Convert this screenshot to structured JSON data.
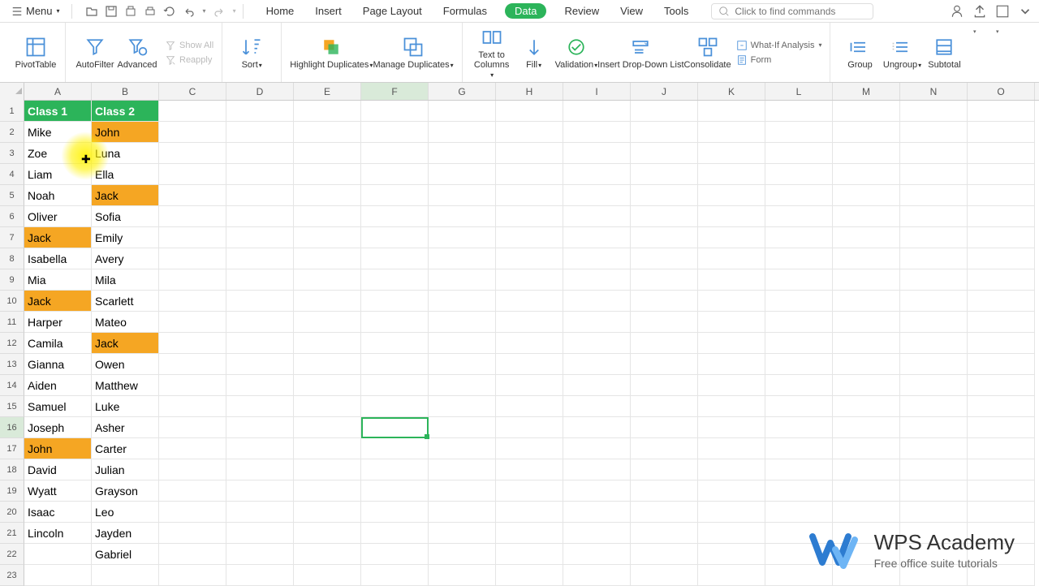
{
  "menu": {
    "label": "Menu"
  },
  "tabs": [
    "Home",
    "Insert",
    "Page Layout",
    "Formulas",
    "Data",
    "Review",
    "View",
    "Tools"
  ],
  "activeTab": "Data",
  "search": {
    "placeholder": "Click to find commands"
  },
  "ribbon": {
    "pivotTable": "PivotTable",
    "autoFilter": "AutoFilter",
    "advanced": "Advanced",
    "showAll": "Show All",
    "reapply": "Reapply",
    "sort": "Sort",
    "highlightDuplicates": "Highlight Duplicates",
    "manageDuplicates": "Manage Duplicates",
    "textToColumns": "Text to\nColumns",
    "fill": "Fill",
    "validation": "Validation",
    "insertDropDown": "Insert Drop-Down List",
    "consolidate": "Consolidate",
    "whatIf": "What-If Analysis",
    "form": "Form",
    "group": "Group",
    "ungroup": "Ungroup",
    "subtotal": "Subtotal"
  },
  "columns": [
    "A",
    "B",
    "C",
    "D",
    "E",
    "F",
    "G",
    "H",
    "I",
    "J",
    "K",
    "L",
    "M",
    "N",
    "O"
  ],
  "selectedColumn": "F",
  "selectedRow": 16,
  "selectedCell": "F16",
  "headers": {
    "A": "Class 1",
    "B": "Class 2"
  },
  "gridData": {
    "A": [
      "Mike",
      "Zoe",
      "Liam",
      "Noah",
      "Oliver",
      "Jack",
      "Isabella",
      "Mia",
      "Jack",
      "Harper",
      "Camila",
      "Gianna",
      "Aiden",
      "Samuel",
      "Joseph",
      "John",
      "David",
      "Wyatt",
      "Isaac",
      "Lincoln",
      ""
    ],
    "B": [
      "John",
      "Luna",
      "Ella",
      "Jack",
      "Sofia",
      "Emily",
      "Avery",
      "Mila",
      "Scarlett",
      "Mateo",
      "Jack",
      "Owen",
      "Matthew",
      "Luke",
      "Asher",
      "Carter",
      "Julian",
      "Grayson",
      "Leo",
      "Jayden",
      "Gabriel"
    ]
  },
  "highlightedOrange": [
    "A7",
    "A10",
    "A17",
    "B2",
    "B5",
    "B12"
  ],
  "cursorHighlight": {
    "row": 3,
    "col": "A"
  },
  "watermark": {
    "title": "WPS Academy",
    "subtitle": "Free office suite tutorials"
  }
}
